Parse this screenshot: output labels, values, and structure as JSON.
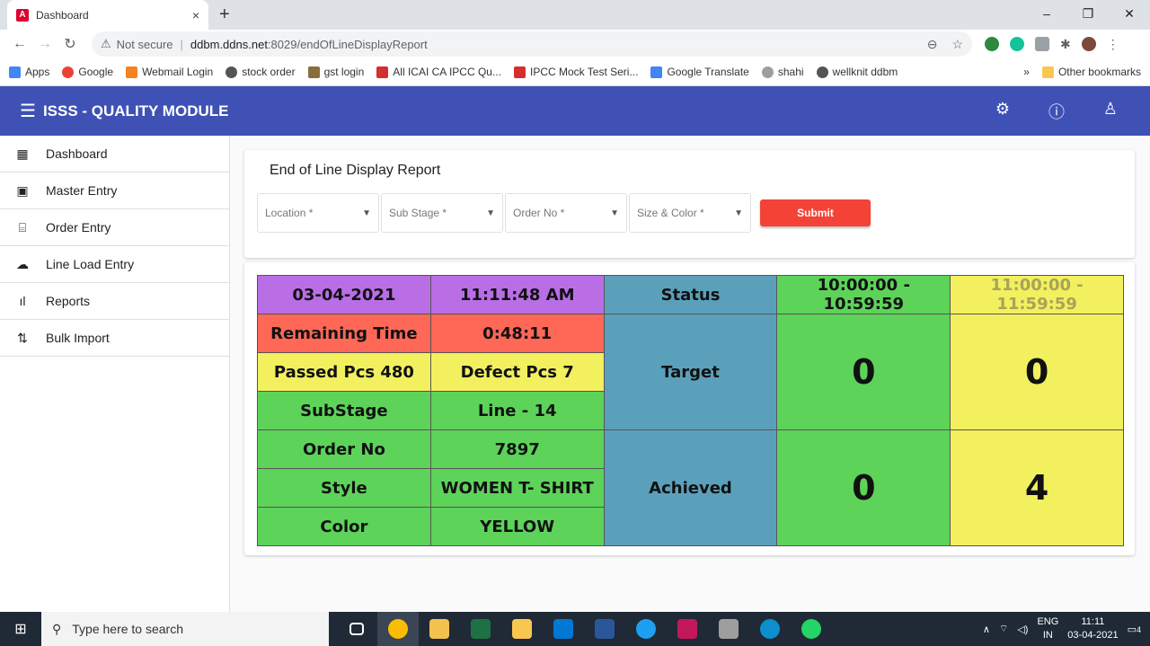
{
  "browser": {
    "tab_title": "Dashboard",
    "tab_close": "×",
    "new_tab": "+",
    "window_controls": [
      "–",
      "❐",
      "✕"
    ],
    "not_secure": "Not secure",
    "url_host": "ddbm.ddns.net",
    "url_path": ":8029/endOfLineDisplayReport",
    "bookmarks": [
      "Apps",
      "Google",
      "Webmail Login",
      "stock order",
      "gst login",
      "All ICAI CA IPCC Qu...",
      "IPCC Mock Test Seri...",
      "Google Translate",
      "shahi",
      "wellknit ddbm"
    ],
    "bookmarks_more": "»",
    "other_bookmarks": "Other bookmarks"
  },
  "app": {
    "title": "ISSS - QUALITY MODULE"
  },
  "sidebar": {
    "items": [
      {
        "label": "Dashboard",
        "icon": "▦"
      },
      {
        "label": "Master Entry",
        "icon": "▣"
      },
      {
        "label": "Order Entry",
        "icon": "⌸"
      },
      {
        "label": "Line Load Entry",
        "icon": "☁"
      },
      {
        "label": "Reports",
        "icon": "ıl"
      },
      {
        "label": "Bulk Import",
        "icon": "⇅"
      }
    ]
  },
  "report": {
    "heading": "End of Line Display Report",
    "filters": {
      "location": "Location *",
      "sub_stage": "Sub Stage *",
      "order_no": "Order No *",
      "size_color": "Size & Color *"
    },
    "submit_label": "Submit",
    "table": {
      "date": "03-04-2021",
      "time": "11:11:48 AM",
      "status_label": "Status",
      "slot1": "10:00:00 - 10:59:59",
      "slot2": "11:00:00 - 11:59:59",
      "remaining_label": "Remaining Time",
      "remaining_value": "0:48:11",
      "passed": "Passed Pcs 480",
      "defect": "Defect Pcs 7",
      "target_label": "Target",
      "target_slot1": "0",
      "target_slot2": "0",
      "substage_label": "SubStage",
      "substage_value": "Line - 14",
      "order_label": "Order No",
      "order_value": "7897",
      "achieved_label": "Achieved",
      "achieved_slot1": "0",
      "achieved_slot2": "4",
      "style_label": "Style",
      "style_value": "WOMEN T- SHIRT",
      "color_label": "Color",
      "color_value": "YELLOW"
    }
  },
  "taskbar": {
    "search_placeholder": "Type here to search",
    "lang_top": "ENG",
    "lang_bottom": "IN",
    "time": "11:11",
    "date": "03-04-2021",
    "notification_count": "4"
  },
  "colors": {
    "appbar": "#3f51b5",
    "submit": "#f44336",
    "purple": "#b96ee6",
    "red": "#ff6757",
    "yellow": "#f2f05f",
    "green": "#5dd35a",
    "blue": "#5ba0bb"
  }
}
